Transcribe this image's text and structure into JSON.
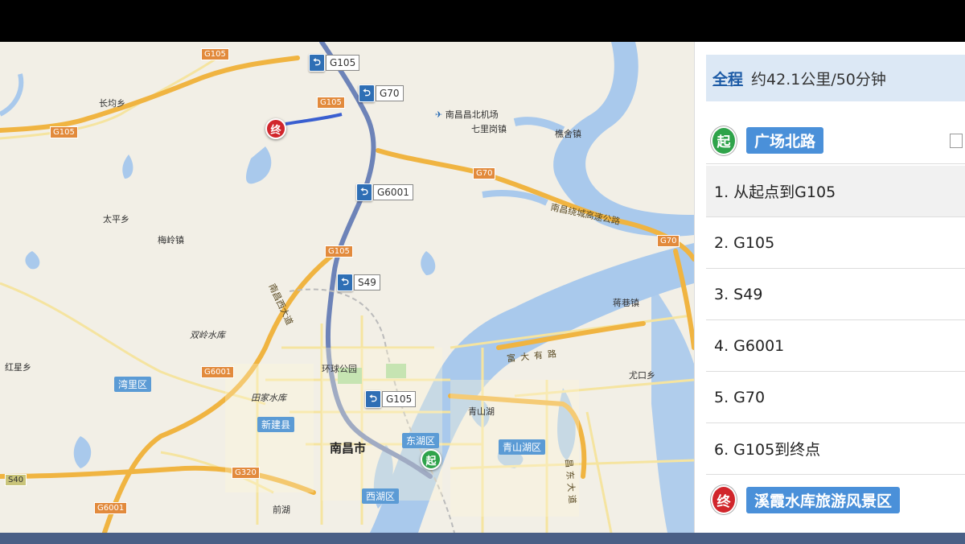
{
  "map": {
    "places": [
      {
        "text": "长均乡"
      },
      {
        "text": "太平乡"
      },
      {
        "text": "梅岭镇"
      },
      {
        "text": "红星乡"
      },
      {
        "text": "七里岗镇"
      },
      {
        "text": "樵舍镇"
      },
      {
        "text": "蒋巷镇"
      },
      {
        "text": "尤口乡"
      },
      {
        "text": "环球公园"
      },
      {
        "text": "青山湖"
      },
      {
        "text": "前湖"
      }
    ],
    "lakes": [
      {
        "text": "双岭水库"
      },
      {
        "text": "田家水库"
      }
    ],
    "airport": "南昌昌北机场",
    "districts": [
      "湾里区",
      "新建县",
      "东湖区",
      "青山湖区",
      "西湖区"
    ],
    "city": "南昌市",
    "road_labels": [
      "南昌绕城高速公路",
      "南昌西大道",
      "富大有路",
      "昌东大道"
    ],
    "highway_shields": [
      "G105",
      "G105",
      "G105",
      "G70",
      "G70",
      "G6001",
      "G6001",
      "G320",
      "S40",
      "G105"
    ],
    "route_markers": [
      "G105",
      "G70",
      "G6001",
      "S49",
      "G105"
    ],
    "start_marker": "起",
    "end_marker": "终",
    "colors": {
      "route": "#6d83b8",
      "highway": "#f2b94a",
      "water": "#a9c9ec",
      "land": "#f2efe6"
    }
  },
  "panel": {
    "summary_link": "全程",
    "summary_text": "约42.1公里/50分钟",
    "start": {
      "badge": "起",
      "name": "广场北路"
    },
    "steps": [
      "1. 从起点到G105",
      "2. G105",
      "3. S49",
      "4. G6001",
      "5. G70",
      "6. G105到终点"
    ],
    "end": {
      "badge": "终",
      "name": "溪霞水库旅游风景区"
    }
  }
}
